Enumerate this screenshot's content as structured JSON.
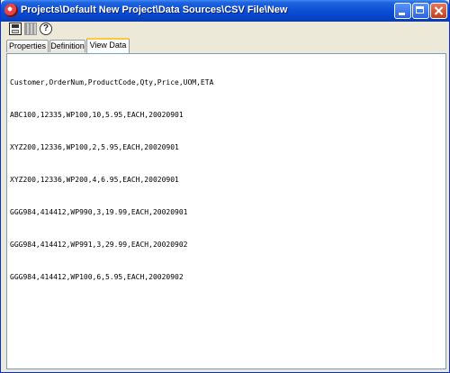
{
  "window": {
    "title": "Projects\\Default New Project\\Data Sources\\CSV File\\New",
    "controls": {
      "minimize": "minimize",
      "maximize": "maximize",
      "close": "close"
    }
  },
  "toolbar": {
    "icons": [
      "save-icon",
      "grid-icon",
      "help-icon"
    ],
    "help_glyph": "?"
  },
  "tabs": [
    {
      "label": "Properties",
      "active": false
    },
    {
      "label": "Definition",
      "active": false
    },
    {
      "label": "View Data",
      "active": true
    }
  ],
  "view_data": {
    "lines": [
      "Customer,OrderNum,ProductCode,Qty,Price,UOM,ETA",
      "ABC100,12335,WP100,10,5.95,EACH,20020901",
      "XYZ200,12336,WP100,2,5.95,EACH,20020901",
      "XYZ200,12336,WP200,4,6.95,EACH,20020901",
      "GGG984,414412,WP990,3,19.99,EACH,20020901",
      "GGG984,414412,WP991,3,29.99,EACH,20020902",
      "GGG984,414412,WP100,6,5.95,EACH,20020902"
    ]
  },
  "colors": {
    "titlebar": "#0a4fd6",
    "active_tab_accent": "#ffc83c",
    "close_button": "#c13f1c"
  }
}
